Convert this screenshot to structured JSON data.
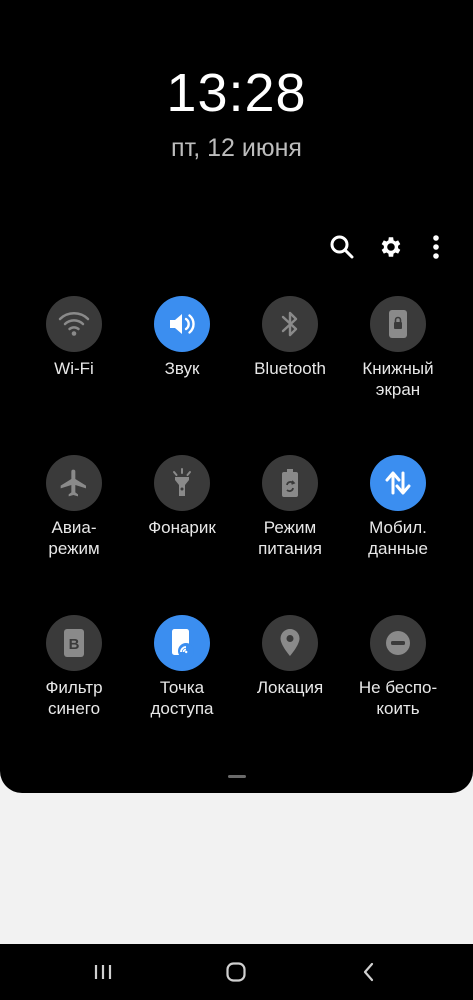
{
  "clock": {
    "time": "13:28",
    "date": "пт, 12 июня"
  },
  "toolbar": {
    "search_icon": "search-icon",
    "settings_icon": "gear-icon",
    "more_icon": "more-vert-icon"
  },
  "tiles": [
    {
      "label": "Wi-Fi",
      "icon": "wifi-icon",
      "active": false
    },
    {
      "label": "Звук",
      "icon": "volume-icon",
      "active": true
    },
    {
      "label": "Bluetooth",
      "icon": "bluetooth-icon",
      "active": false
    },
    {
      "label": "Книжный\nэкран",
      "icon": "portrait-lock-icon",
      "active": false
    },
    {
      "label": "Авиа-\nрежим",
      "icon": "airplane-icon",
      "active": false
    },
    {
      "label": "Фонарик",
      "icon": "flashlight-icon",
      "active": false
    },
    {
      "label": "Режим\nпитания",
      "icon": "battery-saver-icon",
      "active": false
    },
    {
      "label": "Мобил.\nданные",
      "icon": "mobile-data-icon",
      "active": true
    },
    {
      "label": "Фильтр\nсинего",
      "icon": "blue-filter-icon",
      "active": false
    },
    {
      "label": "Точка\nдоступа",
      "icon": "hotspot-icon",
      "active": true
    },
    {
      "label": "Локация",
      "icon": "location-icon",
      "active": false
    },
    {
      "label": "Не беспо-\nкоить",
      "icon": "do-not-disturb-icon",
      "active": false
    }
  ],
  "nav": {
    "recents_icon": "recents-icon",
    "home_icon": "home-icon",
    "back_icon": "back-icon"
  },
  "colors": {
    "panel_bg": "#000000",
    "tile_off": "#3a3a3a",
    "tile_on": "#3b8ef0",
    "page_bg": "#f2f2f2"
  }
}
